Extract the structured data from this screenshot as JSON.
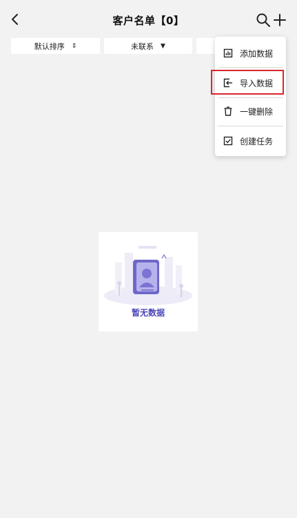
{
  "header": {
    "title": "客户名单【0】"
  },
  "filters": {
    "sort_label": "默认排序",
    "status_label": "未联系"
  },
  "menu": {
    "items": [
      {
        "label": "添加数据",
        "icon": "add-data-icon"
      },
      {
        "label": "导入数据",
        "icon": "import-data-icon"
      },
      {
        "label": "一键删除",
        "icon": "trash-icon"
      },
      {
        "label": "创建任务",
        "icon": "task-check-icon"
      }
    ],
    "highlight_color": "#d8262d"
  },
  "empty_state": {
    "text": "暂无数据",
    "accent_color": "#4b46b8"
  }
}
